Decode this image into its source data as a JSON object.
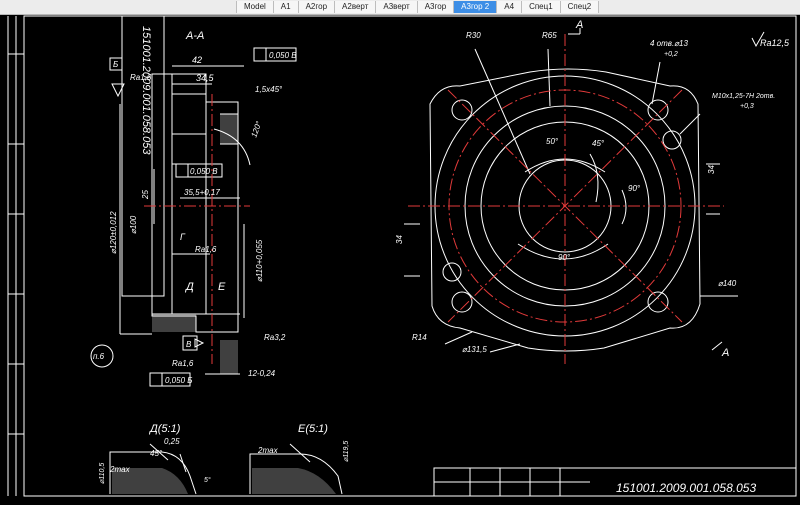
{
  "tabs": [
    {
      "label": "Model"
    },
    {
      "label": "A1"
    },
    {
      "label": "A2гор"
    },
    {
      "label": "A2верт"
    },
    {
      "label": "A3верт"
    },
    {
      "label": "A3гор"
    },
    {
      "label": "A3гор 2",
      "active": true
    },
    {
      "label": "A4"
    },
    {
      "label": "Спец1"
    },
    {
      "label": "Спец2"
    }
  ],
  "drawing": {
    "stamp_rotated": "151001.2009.001.058.053",
    "title_number": "151001.2009.001.058.053",
    "section_aa": "А-А",
    "roughness_general": "Ra12,5",
    "view_a": "А",
    "left_view": {
      "dim_42": "42",
      "dim_34_5": "34,5",
      "dim_35_5": "35,5+0,17",
      "dim_25": "25",
      "dia_120": "⌀120±0,012",
      "dia_100": "⌀100",
      "dia_110": "⌀110+0,055",
      "chamfer": "1,5x45°",
      "angle_120": "120°",
      "tol_top": "0,050 В",
      "tol_mid": "0,050 В",
      "tol_bottom": "0,050 Б",
      "datum_b": "Б",
      "datum_v": "В",
      "ra16_a": "Ra1,6",
      "ra16_b": "Ra1,6",
      "ra16_c": "Ra1,6",
      "ra32": "Ra3,2",
      "label_g": "Г",
      "label_d": "Д",
      "label_e": "Е",
      "dim_12": "12-0,24",
      "note_p6": "п.6"
    },
    "right_view": {
      "r30": "R30",
      "r65": "R65",
      "holes_4": "4 отв.⌀13",
      "holes_4_tol": "+0,2",
      "thread": "М10х1,25-7Н 2отв.",
      "thread_tol": "+0,3",
      "a50": "50°",
      "a45": "45°",
      "a90a": "90°",
      "a90b": "90°",
      "d34a": "34",
      "d34b": "34",
      "d140": "⌀140",
      "d131": "⌀131,5",
      "r14": "R14"
    },
    "details": {
      "detail_d": "Д(5:1)",
      "detail_e": "Е(5:1)",
      "d025": "0,25",
      "d2max_a": "2max",
      "d2max_b": "2max",
      "a45": "45°",
      "d110_5": "⌀110,5",
      "d119_5": "⌀119,5",
      "a5": "5°"
    }
  }
}
